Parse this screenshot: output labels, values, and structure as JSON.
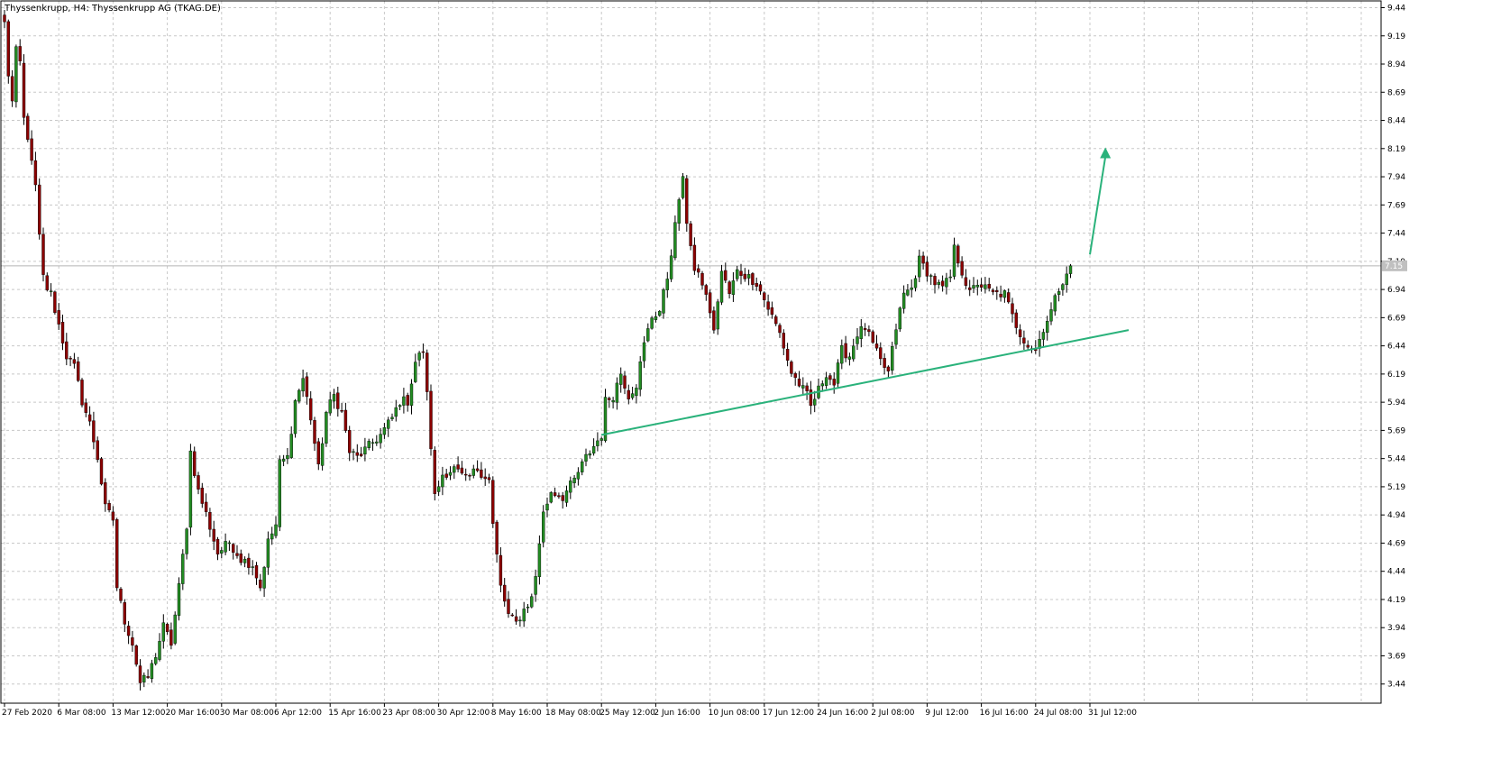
{
  "chart_data": {
    "type": "candlestick",
    "title": "Thyssenkrupp, H4:  Thyssenkrupp AG (TKAG.DE)",
    "ylim": [
      3.27,
      9.5
    ],
    "y_ticks": [
      "9.44",
      "9.19",
      "8.94",
      "8.69",
      "8.44",
      "8.19",
      "7.94",
      "7.69",
      "7.44",
      "7.19",
      "6.94",
      "6.69",
      "6.44",
      "6.19",
      "5.94",
      "5.69",
      "5.44",
      "5.19",
      "4.94",
      "4.69",
      "4.44",
      "4.19",
      "3.94",
      "3.69",
      "3.44"
    ],
    "x_ticks": [
      "27 Feb 2020",
      "6 Mar 08:00",
      "13 Mar 12:00",
      "20 Mar 16:00",
      "30 Mar 08:00",
      "6 Apr 12:00",
      "15 Apr 16:00",
      "23 Apr 08:00",
      "30 Apr 12:00",
      "8 May 16:00",
      "18 May 08:00",
      "25 May 12:00",
      "2 Jun 16:00",
      "10 Jun 08:00",
      "17 Jun 12:00",
      "24 Jun 16:00",
      "2 Jul 08:00",
      "9 Jul 12:00",
      "16 Jul 16:00",
      "24 Jul 08:00",
      "31 Jul 12:00"
    ],
    "x_tick_bars": [
      0,
      14,
      28,
      42,
      56,
      70,
      84,
      98,
      112,
      126,
      140,
      154,
      168,
      182,
      196,
      210,
      224,
      238,
      252,
      266,
      280
    ],
    "current_price": "7.15",
    "path": [
      [
        0,
        9.3
      ],
      [
        1,
        8.85
      ],
      [
        2,
        8.6
      ],
      [
        3,
        9.05
      ],
      [
        4,
        8.95
      ],
      [
        5,
        8.45
      ],
      [
        6,
        8.3
      ],
      [
        7,
        8.05
      ],
      [
        8,
        7.85
      ],
      [
        9,
        7.4
      ],
      [
        10,
        7.05
      ],
      [
        11,
        6.95
      ],
      [
        12,
        6.9
      ],
      [
        16,
        6.35
      ],
      [
        18,
        6.25
      ],
      [
        20,
        5.95
      ],
      [
        22,
        5.75
      ],
      [
        24,
        5.45
      ],
      [
        26,
        5.0
      ],
      [
        28,
        4.9
      ],
      [
        29,
        4.3
      ],
      [
        31,
        4.0
      ],
      [
        33,
        3.8
      ],
      [
        35,
        3.45
      ],
      [
        37,
        3.5
      ],
      [
        39,
        3.7
      ],
      [
        41,
        3.95
      ],
      [
        43,
        3.8
      ],
      [
        45,
        4.3
      ],
      [
        47,
        4.85
      ],
      [
        48,
        5.5
      ],
      [
        50,
        5.15
      ],
      [
        52,
        4.95
      ],
      [
        55,
        4.6
      ],
      [
        58,
        4.7
      ],
      [
        61,
        4.55
      ],
      [
        64,
        4.5
      ],
      [
        66,
        4.3
      ],
      [
        68,
        4.7
      ],
      [
        70,
        4.85
      ],
      [
        71,
        5.4
      ],
      [
        73,
        5.45
      ],
      [
        75,
        5.95
      ],
      [
        77,
        6.15
      ],
      [
        79,
        5.8
      ],
      [
        81,
        5.35
      ],
      [
        83,
        5.85
      ],
      [
        85,
        6.0
      ],
      [
        87,
        5.85
      ],
      [
        89,
        5.5
      ],
      [
        91,
        5.45
      ],
      [
        94,
        5.55
      ],
      [
        97,
        5.65
      ],
      [
        100,
        5.8
      ],
      [
        102,
        5.95
      ],
      [
        104,
        5.95
      ],
      [
        106,
        6.3
      ],
      [
        108,
        6.4
      ],
      [
        109,
        6.0
      ],
      [
        111,
        5.1
      ],
      [
        113,
        5.3
      ],
      [
        116,
        5.35
      ],
      [
        119,
        5.25
      ],
      [
        122,
        5.35
      ],
      [
        125,
        5.25
      ],
      [
        126,
        4.85
      ],
      [
        128,
        4.3
      ],
      [
        130,
        4.05
      ],
      [
        132,
        3.98
      ],
      [
        134,
        4.1
      ],
      [
        136,
        4.2
      ],
      [
        137,
        4.4
      ],
      [
        138,
        4.7
      ],
      [
        139,
        4.95
      ],
      [
        141,
        5.15
      ],
      [
        144,
        5.1
      ],
      [
        147,
        5.25
      ],
      [
        150,
        5.45
      ],
      [
        153,
        5.6
      ],
      [
        154,
        5.65
      ],
      [
        155,
        5.95
      ],
      [
        157,
        6.0
      ],
      [
        159,
        6.2
      ],
      [
        161,
        6.0
      ],
      [
        163,
        6.1
      ],
      [
        165,
        6.45
      ],
      [
        167,
        6.7
      ],
      [
        169,
        6.75
      ],
      [
        171,
        7.05
      ],
      [
        173,
        7.5
      ],
      [
        174,
        7.75
      ],
      [
        175,
        7.9
      ],
      [
        176,
        7.55
      ],
      [
        177,
        7.35
      ],
      [
        178,
        7.1
      ],
      [
        180,
        7.0
      ],
      [
        182,
        6.75
      ],
      [
        183,
        6.55
      ],
      [
        184,
        6.85
      ],
      [
        185,
        7.1
      ],
      [
        187,
        6.9
      ],
      [
        189,
        7.1
      ],
      [
        192,
        7.05
      ],
      [
        194,
        7.0
      ],
      [
        196,
        6.85
      ],
      [
        198,
        6.7
      ],
      [
        200,
        6.55
      ],
      [
        203,
        6.2
      ],
      [
        205,
        6.1
      ],
      [
        207,
        6.0
      ],
      [
        208,
        5.9
      ],
      [
        210,
        6.05
      ],
      [
        212,
        6.2
      ],
      [
        214,
        6.1
      ],
      [
        216,
        6.4
      ],
      [
        218,
        6.35
      ],
      [
        220,
        6.55
      ],
      [
        222,
        6.6
      ],
      [
        224,
        6.45
      ],
      [
        226,
        6.3
      ],
      [
        228,
        6.2
      ],
      [
        229,
        6.4
      ],
      [
        230,
        6.6
      ],
      [
        232,
        6.9
      ],
      [
        234,
        6.95
      ],
      [
        236,
        7.2
      ],
      [
        238,
        7.1
      ],
      [
        240,
        7.0
      ],
      [
        242,
        6.95
      ],
      [
        244,
        7.05
      ],
      [
        245,
        7.3
      ],
      [
        247,
        7.1
      ],
      [
        249,
        6.9
      ],
      [
        251,
        7.0
      ],
      [
        253,
        6.95
      ],
      [
        255,
        6.9
      ],
      [
        258,
        6.9
      ],
      [
        260,
        6.7
      ],
      [
        262,
        6.55
      ],
      [
        264,
        6.45
      ],
      [
        266,
        6.4
      ],
      [
        268,
        6.6
      ],
      [
        270,
        6.75
      ],
      [
        272,
        6.95
      ],
      [
        274,
        7.1
      ],
      [
        275,
        7.15
      ]
    ],
    "trendline": {
      "from": [
        154,
        5.65
      ],
      "to": [
        290,
        6.58
      ]
    },
    "arrow": {
      "from": [
        280,
        7.25
      ],
      "to": [
        284,
        8.2
      ]
    }
  },
  "colors": {
    "bull": "#228b22",
    "bear": "#8b0000",
    "wick": "#000000",
    "grid": "#c8c8c8",
    "trendline": "#2ab27b",
    "price_line": "#b4b4b4",
    "price_label_bg": "#c0c0c0"
  }
}
